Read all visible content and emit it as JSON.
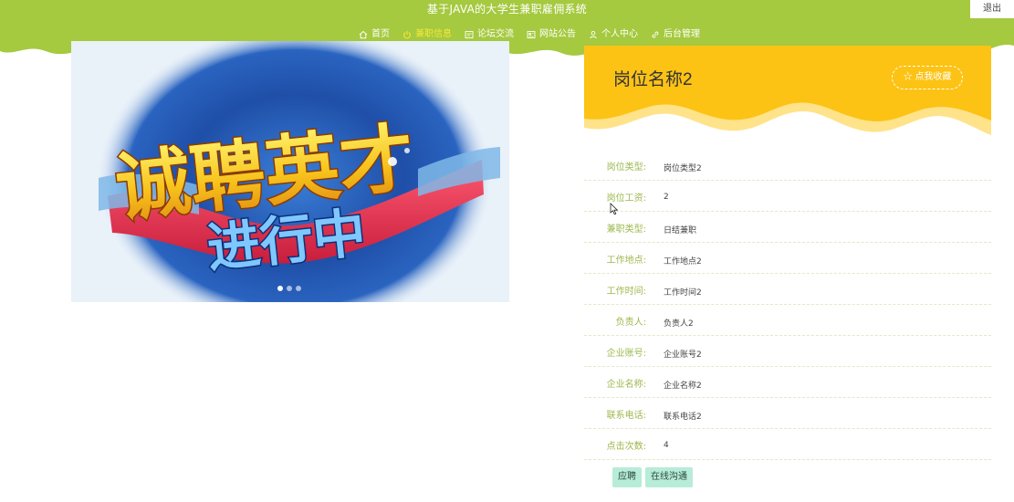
{
  "header": {
    "site_title": "基于JAVA的大学生兼职雇佣系统",
    "logout_label": "退出",
    "nav": [
      {
        "label": "首页",
        "icon": "home-icon",
        "active": false
      },
      {
        "label": "兼职信息",
        "icon": "power-icon",
        "active": true
      },
      {
        "label": "论坛交流",
        "icon": "forum-icon",
        "active": false
      },
      {
        "label": "网站公告",
        "icon": "notice-icon",
        "active": false
      },
      {
        "label": "个人中心",
        "icon": "user-icon",
        "active": false
      },
      {
        "label": "后台管理",
        "icon": "link-icon",
        "active": false
      }
    ]
  },
  "banner": {
    "line1": "诚聘英才",
    "line2": "进行中"
  },
  "job": {
    "title": "岗位名称2",
    "favorite_label": "☆ 点我收藏",
    "fields": [
      {
        "label": "岗位类型:",
        "value": "岗位类型2"
      },
      {
        "label": "岗位工资:",
        "value": "2"
      },
      {
        "label": "兼职类型:",
        "value": "日结兼职"
      },
      {
        "label": "工作地点:",
        "value": "工作地点2"
      },
      {
        "label": "工作时间:",
        "value": "工作时间2"
      },
      {
        "label": "负责人:",
        "value": "负责人2"
      },
      {
        "label": "企业账号:",
        "value": "企业账号2"
      },
      {
        "label": "企业名称:",
        "value": "企业名称2"
      },
      {
        "label": "联系电话:",
        "value": "联系电话2"
      },
      {
        "label": "点击次数:",
        "value": "4"
      }
    ]
  },
  "actions": {
    "apply_label": "应聘",
    "chat_label": "在线沟通"
  },
  "colors": {
    "header_green": "#a5c93f",
    "nav_active": "#f6e838",
    "title_yellow": "#fcc315",
    "label_green": "#9cb84c",
    "button_mint": "#b7ecd9"
  }
}
